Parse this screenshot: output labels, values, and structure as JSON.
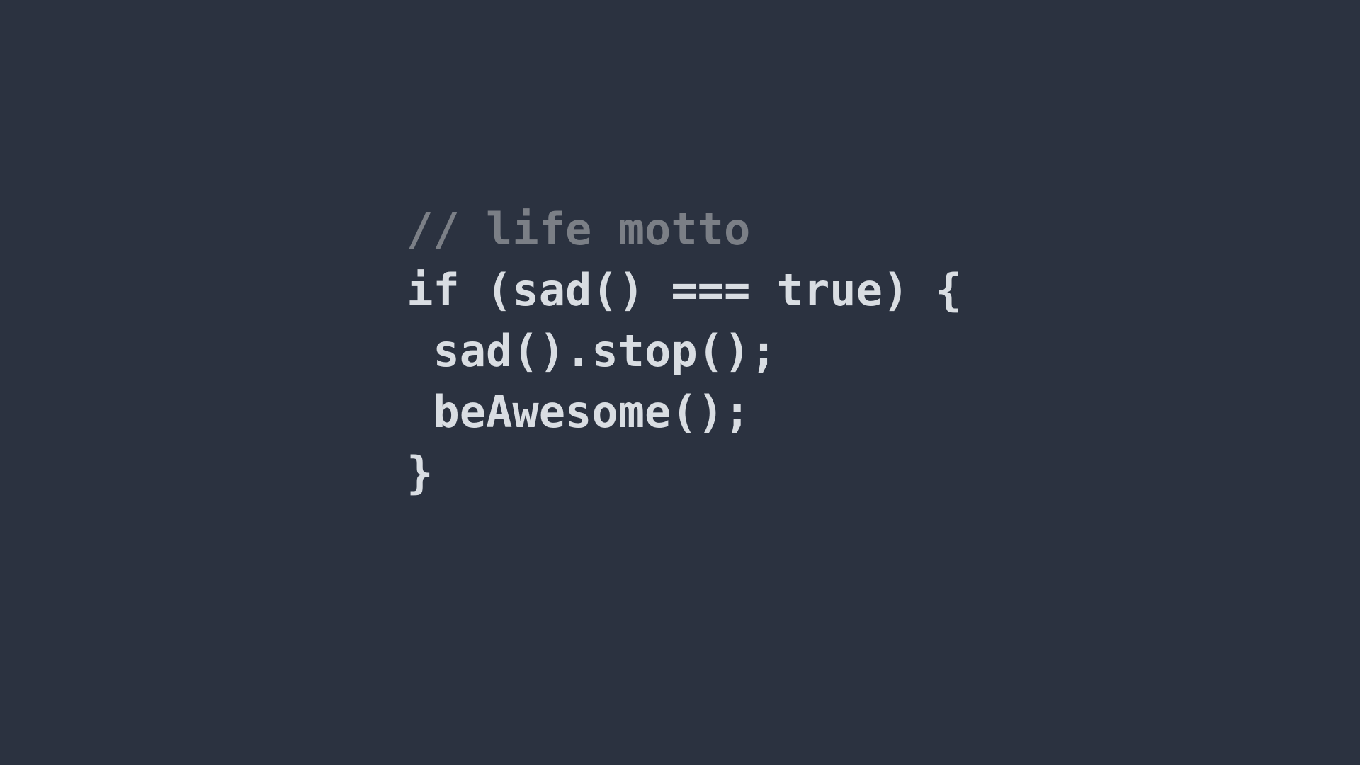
{
  "code": {
    "line1": "// life motto",
    "line2": "if (sad() === true) {",
    "line3": " sad().stop();",
    "line4": " beAwesome();",
    "line5": "}"
  },
  "colors": {
    "background": "#2b3240",
    "comment": "#7b7f86",
    "code": "#d9dde2"
  }
}
